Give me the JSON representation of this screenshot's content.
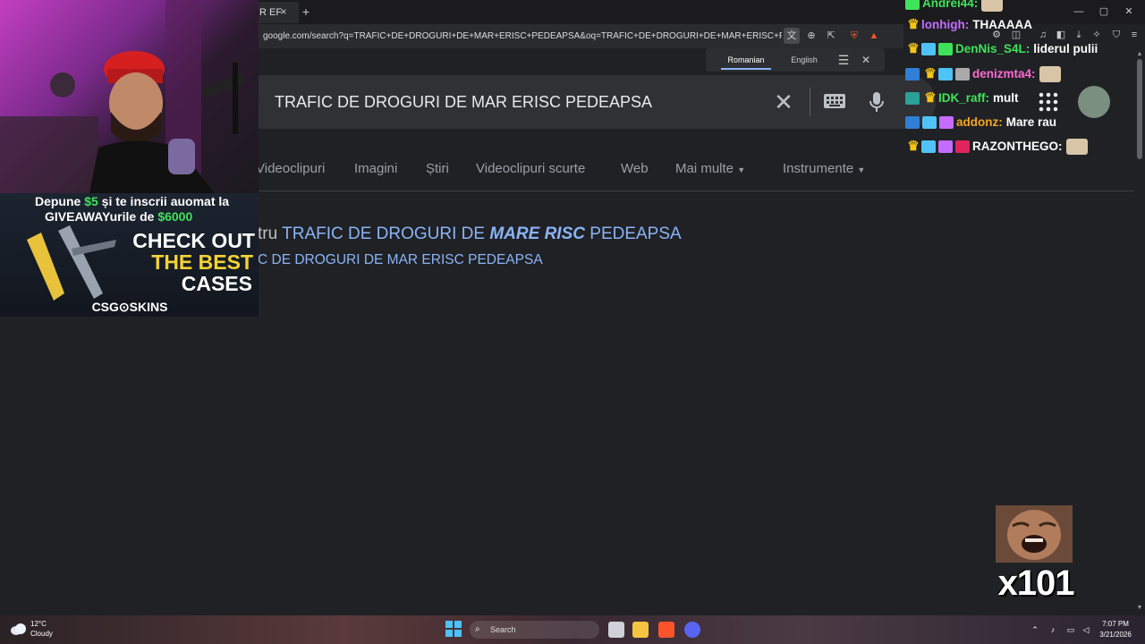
{
  "browser": {
    "tab_title": "R EF",
    "tab_close": "×",
    "new_tab": "+",
    "url": "google.com/search?q=TRAFIC+DE+DROGURI+DE+MAR+ERISC+PEDEAPSA&oq=TRAFIC+DE+DROGURI+DE+MAR+ERISC+PEDEAPSA&g...",
    "window_controls": {
      "minimize": "—",
      "maximize": "▢",
      "close": "✕"
    }
  },
  "translate": {
    "source_lang": "Romanian",
    "target_lang": "English",
    "close": "✕"
  },
  "search": {
    "query": "TRAFIC DE DROGURI DE MAR ERISC PEDEAPSA",
    "clear": "✕"
  },
  "nav_tabs": [
    {
      "label": "Videoclipuri"
    },
    {
      "label": "Imagini"
    },
    {
      "label": "Știri"
    },
    {
      "label": "Videoclipuri scurte"
    },
    {
      "label": "Web"
    },
    {
      "label": "Mai multe"
    },
    {
      "label": "Instrumente"
    }
  ],
  "spelling": {
    "prefix": "tru",
    "corrected_part1": "TRAFIC DE DROGURI DE",
    "corrected_emph": "MARE RISC",
    "corrected_part2": "PEDEAPSA",
    "instead_text": "C DE DROGURI DE MAR ERISC PEDEAPSA"
  },
  "ad": {
    "line1_pre": "Depune",
    "line1_amount": "$5",
    "line1_post": "și te inscrii auomat la",
    "line2_pre": "GIVEAWAYurile de",
    "line2_amount": "$6000",
    "check_out": "CHECK OUT",
    "the_best": "THE BEST",
    "cases": "CASES",
    "brand": "CSG⊙SKINS"
  },
  "chat": {
    "messages": [
      {
        "user": "Andrei44:",
        "color": "#3fe35a",
        "text": ""
      },
      {
        "user": "lonhigh:",
        "color": "#c56bff",
        "text": "THAAAAA"
      },
      {
        "user": "DenNis_S4L:",
        "color": "#3fe35a",
        "text": "liderul pulii"
      },
      {
        "user": "denizmta4:",
        "color": "#ff6ad5",
        "text": ""
      },
      {
        "user": "IDK_raff:",
        "color": "#3fe35a",
        "text": "mult"
      },
      {
        "user": "addonz:",
        "color": "#f5a623",
        "text": "Mare rau"
      },
      {
        "user": "RAZONTHEGO:",
        "color": "#ffffff",
        "text": ""
      }
    ]
  },
  "meme": {
    "count": "x101"
  },
  "taskbar": {
    "weather_temp": "12°C",
    "weather_desc": "Cloudy",
    "search_label": "Search",
    "time": "7:07 PM",
    "date": "3/21/2026"
  },
  "colors": {
    "link": "#8ab4f8",
    "page_bg": "#202124",
    "search_bg": "#303134"
  }
}
